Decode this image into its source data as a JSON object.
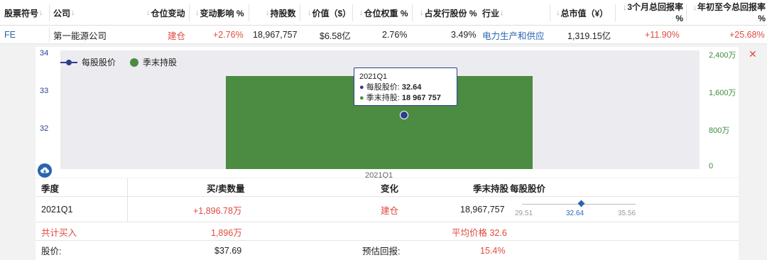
{
  "table": {
    "headers": {
      "ticker": "股票符号",
      "company": "公司",
      "position_change": "仓位变动",
      "change_impact": "变动影响 %",
      "shares": "持股数",
      "value": "价值（$）",
      "weight": "仓位权重 %",
      "pct_outstanding": "占发行股份 %",
      "industry": "行业",
      "market_cap": "总市值（¥）",
      "return_3m_line1": "3个月总回报率",
      "return_3m_line2": "%",
      "return_ytd_line1": "年初至今总回报率",
      "return_ytd_line2": "%"
    },
    "row": {
      "ticker": "FE",
      "company": "第一能源公司",
      "position_change": "建仓",
      "change_impact": "+2.76%",
      "shares": "18,967,757",
      "value": "$6.58亿",
      "weight": "2.76%",
      "pct_outstanding": "3.49%",
      "industry": "电力生产和供应",
      "market_cap": "1,319.15亿",
      "return_3m": "+11.90%",
      "return_ytd": "+25.68%"
    },
    "close_glyph": "✕",
    "sort_glyph": "↓"
  },
  "chart_data": {
    "type": "bar",
    "categories": [
      "2021Q1"
    ],
    "series": [
      {
        "name": "季末持股",
        "type": "bar",
        "axis": "right",
        "values": [
          18967757
        ],
        "color": "#4b8c42"
      },
      {
        "name": "每股股价",
        "type": "line",
        "axis": "left",
        "values": [
          32.64
        ],
        "color": "#2c3e8f"
      }
    ],
    "left_axis": {
      "ticks": [
        "34",
        "33",
        "32"
      ],
      "range": [
        31.5,
        34
      ]
    },
    "right_axis": {
      "ticks": [
        "2,400万",
        "1,600万",
        "800万",
        "0"
      ],
      "range": [
        0,
        24000000
      ]
    },
    "legend_position": "top-left",
    "tooltip": {
      "title": "2021Q1",
      "price_label": "每股股价:",
      "price_value": "32.64",
      "holding_label": "季末持股:",
      "holding_value": "18 967 757"
    }
  },
  "detail": {
    "headers": {
      "quarter": "季度",
      "buy_sell": "买/卖数量",
      "change": "变化",
      "holding": "季末持股",
      "price": "每股股价"
    },
    "row": {
      "quarter": "2021Q1",
      "buy_sell": "+1,896.78万",
      "change": "建仓",
      "holding": "18,967,757",
      "range_low": "29.51",
      "range_mid": "32.64",
      "range_high": "35.56"
    },
    "summary": {
      "total_buy_label": "共计买入",
      "total_buy_value": "1,896万",
      "avg_price_label": "平均价格 32.6"
    },
    "price_row": {
      "price_label": "股价:",
      "price_value": "$37.69",
      "est_return_label": "预估回报:",
      "est_return_value": "15.4%"
    }
  },
  "colors": {
    "accent_blue": "#2a64b0",
    "red": "#e04a3f",
    "bar_green": "#4b8c42",
    "line_navy": "#2c3e8f"
  },
  "icons": [
    "sort-arrow-icon",
    "close-icon",
    "download-icon"
  ]
}
